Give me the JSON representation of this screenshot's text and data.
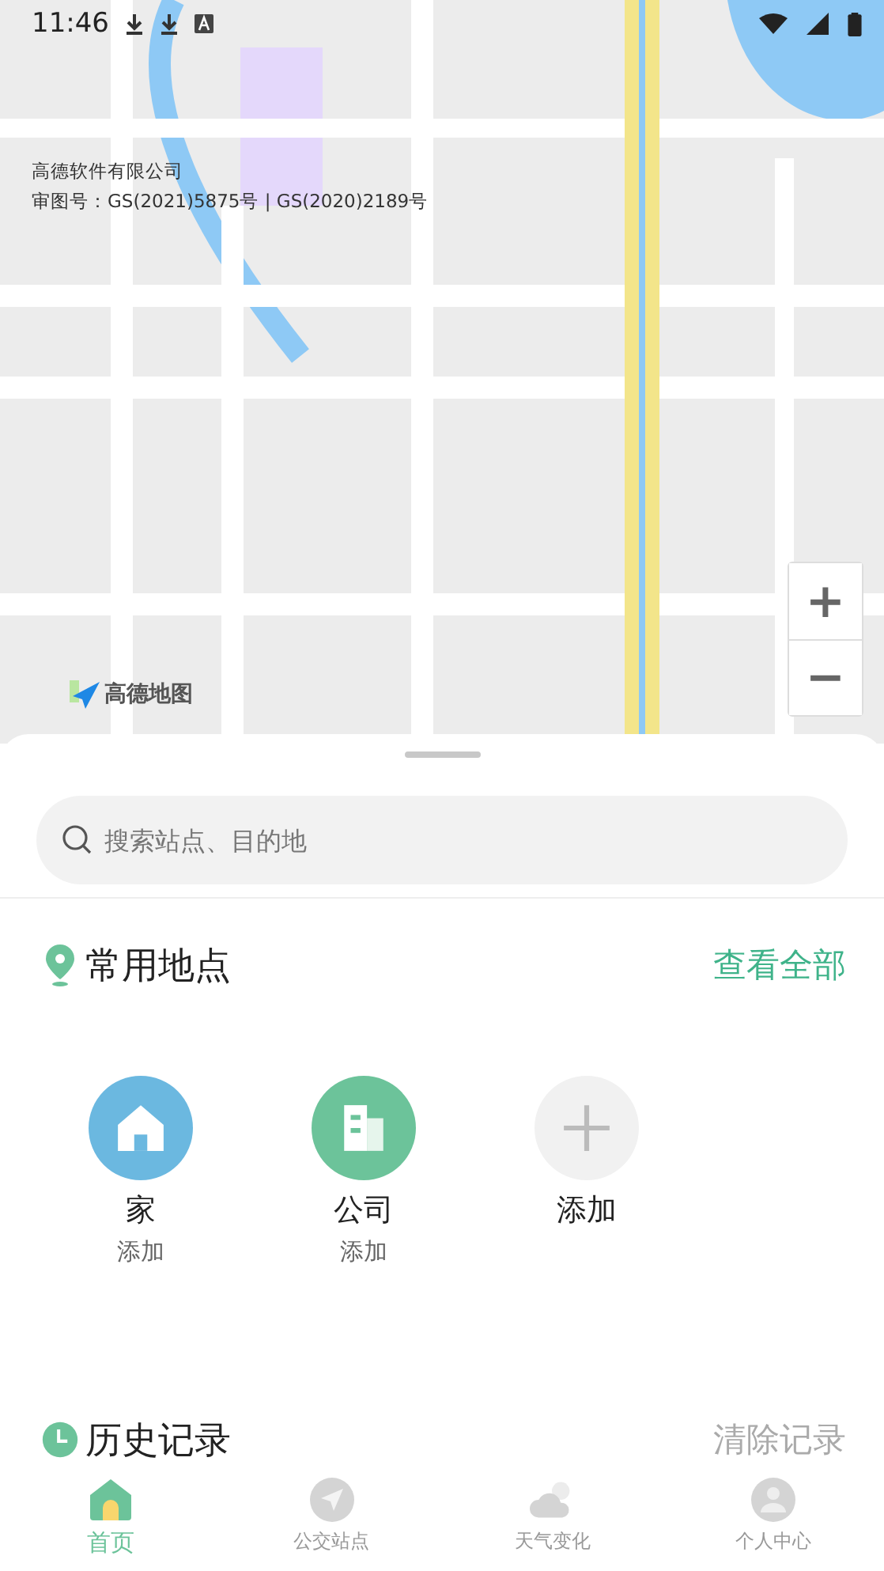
{
  "status_bar": {
    "time": "11:46"
  },
  "map": {
    "attribution": [
      "高德软件有限公司",
      "审图号：GS(2021)5875号 | GS(2020)2189号"
    ],
    "logo": "高德地图",
    "zoom_in": "+",
    "zoom_out": "−"
  },
  "search": {
    "placeholder": "搜索站点、目的地"
  },
  "favorites": {
    "title": "常用地点",
    "action": "查看全部",
    "items": [
      {
        "kind": "home",
        "label": "家",
        "sub": "添加"
      },
      {
        "kind": "office",
        "label": "公司",
        "sub": "添加"
      },
      {
        "kind": "add",
        "label": "添加"
      }
    ]
  },
  "history": {
    "title": "历史记录",
    "action": "清除记录"
  },
  "tabs": [
    {
      "kind": "home",
      "label": "首页",
      "selected": true
    },
    {
      "kind": "bus",
      "label": "公交站点",
      "selected": false
    },
    {
      "kind": "weather",
      "label": "天气变化",
      "selected": false
    },
    {
      "kind": "profile",
      "label": "个人中心",
      "selected": false
    }
  ]
}
